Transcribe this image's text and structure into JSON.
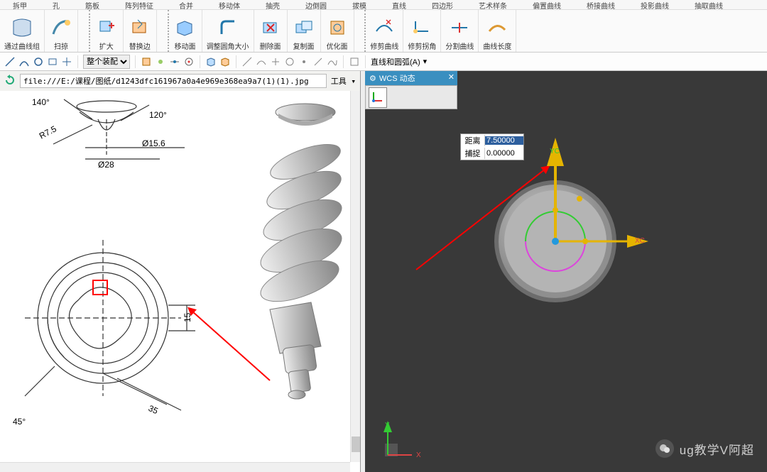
{
  "ribbon_tabs": [
    "拆甲",
    "孔",
    "筋板",
    "阵列特征",
    "合并",
    "移动体",
    "抽壳",
    "边倒圆",
    "拔模",
    "直线",
    "四边形",
    "艺术样条",
    "偏置曲线",
    "桥接曲线",
    "投影曲线",
    "抽取曲线"
  ],
  "ribbon": {
    "g1": "通过曲线组",
    "g2": "扫掠",
    "g3": "扩大",
    "g4": "替换边",
    "g5": "移动面",
    "g6": "调整圆角大小",
    "g7": "删除面",
    "g8": "复制面",
    "g9": "优化面",
    "g10": "修剪曲线",
    "g11": "修剪拐角",
    "g12": "分割曲线",
    "g13": "曲线长度"
  },
  "assembly_option": "整个装配",
  "curve_mode": "直线和圆弧(A)",
  "url": "file:///E:/课程/图纸/d1243dfc161967a0a4e969e368ea9a7(1)(1).jpg",
  "tool_label": "工具",
  "wcs_title": "WCS 动态",
  "distance_label": "距离",
  "distance_value": "7.50000",
  "snap_label": "捕捉",
  "snap_value": "0.00000",
  "axis_yc": "YC",
  "axis_xc": "XC",
  "corner_y": "Y",
  "corner_x": "X",
  "watermark": "ug教学V阿超",
  "drawing": {
    "angle140": "140°",
    "angle120": "120°",
    "r75": "R7.5",
    "d156": "Ø15.6",
    "d28": "Ø28",
    "dim15": "15",
    "angle45": "45°",
    "dim35": "35"
  }
}
